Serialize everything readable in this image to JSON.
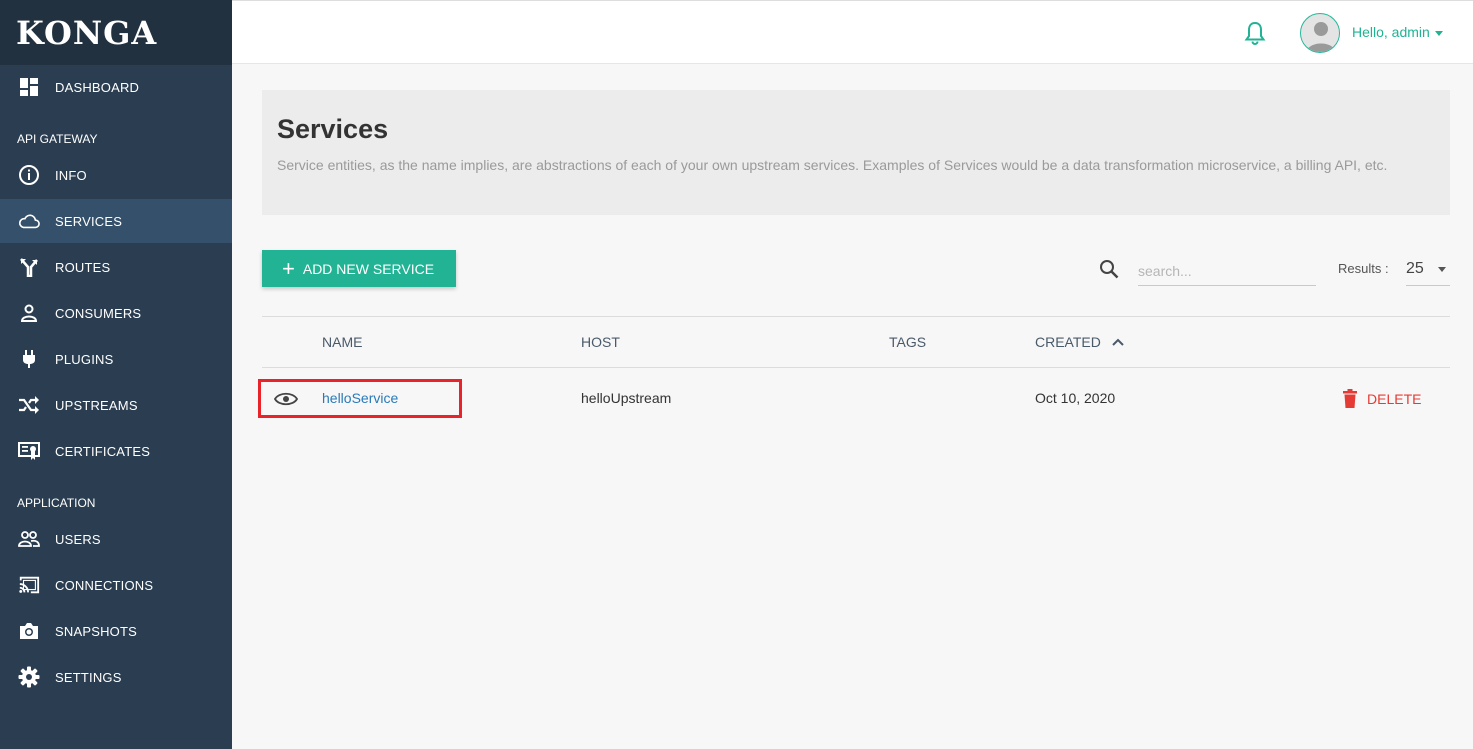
{
  "brand": {
    "name": "KONGA"
  },
  "sidebar": {
    "items": [
      {
        "label": "DASHBOARD",
        "icon": "dashboard-icon"
      },
      {
        "label": "INFO",
        "icon": "info-icon"
      },
      {
        "label": "SERVICES",
        "icon": "cloud-icon",
        "active": true
      },
      {
        "label": "ROUTES",
        "icon": "routes-icon"
      },
      {
        "label": "CONSUMERS",
        "icon": "user-icon"
      },
      {
        "label": "PLUGINS",
        "icon": "plug-icon"
      },
      {
        "label": "UPSTREAMS",
        "icon": "shuffle-icon"
      },
      {
        "label": "CERTIFICATES",
        "icon": "certificate-icon"
      },
      {
        "label": "USERS",
        "icon": "users-icon"
      },
      {
        "label": "CONNECTIONS",
        "icon": "cast-icon"
      },
      {
        "label": "SNAPSHOTS",
        "icon": "camera-icon"
      },
      {
        "label": "SETTINGS",
        "icon": "gear-icon"
      }
    ],
    "sections": {
      "api_gateway": "API GATEWAY",
      "application": "APPLICATION"
    }
  },
  "topbar": {
    "greeting": "Hello, admin"
  },
  "page": {
    "title": "Services",
    "description": "Service entities, as the name implies, are abstractions of each of your own upstream services. Examples of Services would be a data transformation microservice, a billing API, etc."
  },
  "toolbar": {
    "add_label": "ADD NEW SERVICE",
    "search_placeholder": "search...",
    "results_label": "Results :",
    "results_value": "25"
  },
  "table": {
    "headers": {
      "name": "NAME",
      "host": "HOST",
      "tags": "TAGS",
      "created": "CREATED"
    },
    "rows": [
      {
        "name": "helloService",
        "host": "helloUpstream",
        "tags": "",
        "created": "Oct 10, 2020",
        "action": "DELETE"
      }
    ]
  },
  "colors": {
    "accent": "#21b394",
    "sidebar": "#2b3e51",
    "danger": "#e53b35",
    "link": "#2a7ab8"
  }
}
